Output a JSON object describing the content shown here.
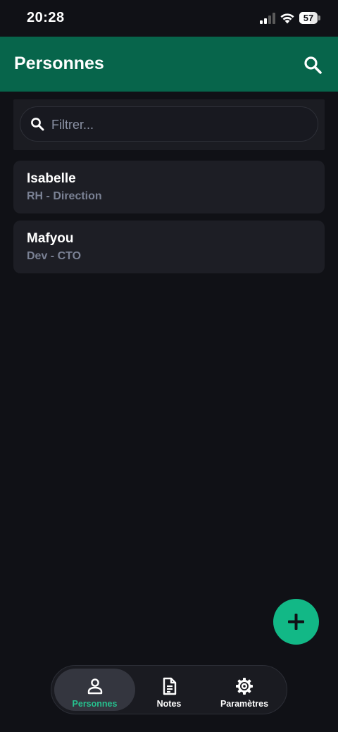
{
  "status_bar": {
    "time": "20:28",
    "battery_level": "57",
    "battery_fraction": 0.57
  },
  "app_bar": {
    "title": "Personnes",
    "search_icon": "search-icon"
  },
  "filter": {
    "placeholder": "Filtrer...",
    "value": "",
    "icon": "search-icon"
  },
  "people": [
    {
      "name": "Isabelle",
      "role": "RH - Direction"
    },
    {
      "name": "Mafyou",
      "role": "Dev - CTO"
    }
  ],
  "fab": {
    "icon": "plus-icon"
  },
  "bottom_nav": {
    "items": [
      {
        "label": "Personnes",
        "icon": "person-icon",
        "active": true
      },
      {
        "label": "Notes",
        "icon": "document-icon",
        "active": false
      },
      {
        "label": "Paramètres",
        "icon": "gear-icon",
        "active": false
      }
    ]
  },
  "colors": {
    "background": "#101116",
    "app_bar": "#07654b",
    "card": "#1d1e25",
    "accent": "#12b886",
    "active_label": "#26c08e",
    "secondary_text": "#7a8194"
  }
}
